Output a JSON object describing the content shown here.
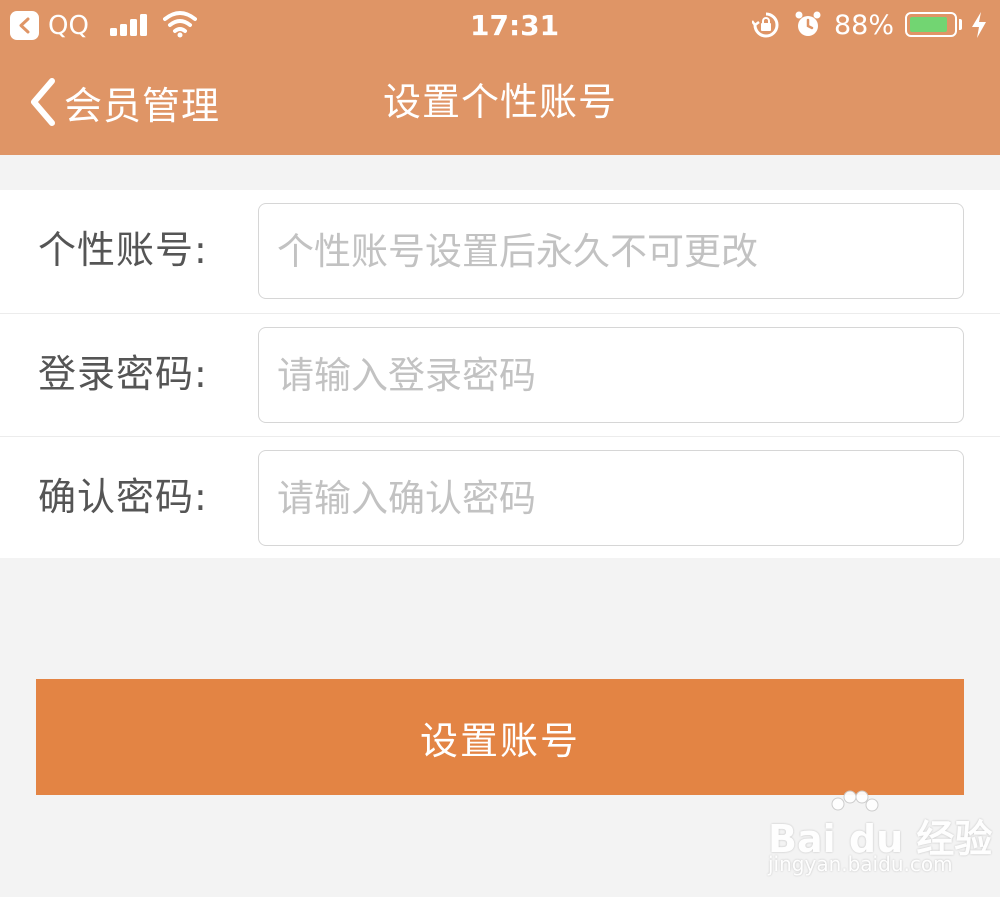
{
  "status_bar": {
    "back_app": "QQ",
    "time": "17:31",
    "battery_percent": "88%",
    "battery_level": 0.88,
    "battery_color": "#72d572"
  },
  "nav": {
    "back_label": "会员管理",
    "title": "设置个性账号"
  },
  "form": {
    "rows": [
      {
        "label": "个性账号:",
        "placeholder": "个性账号设置后永久不可更改",
        "value": ""
      },
      {
        "label": "登录密码:",
        "placeholder": "请输入登录密码",
        "value": ""
      },
      {
        "label": "确认密码:",
        "placeholder": "请输入确认密码",
        "value": ""
      }
    ]
  },
  "submit_label": "设置账号",
  "watermark": {
    "brand": "Bai du 经验",
    "url": "jingyan.baidu.com"
  },
  "colors": {
    "header": "#df9566",
    "button": "#e38444",
    "background": "#f3f3f3"
  }
}
